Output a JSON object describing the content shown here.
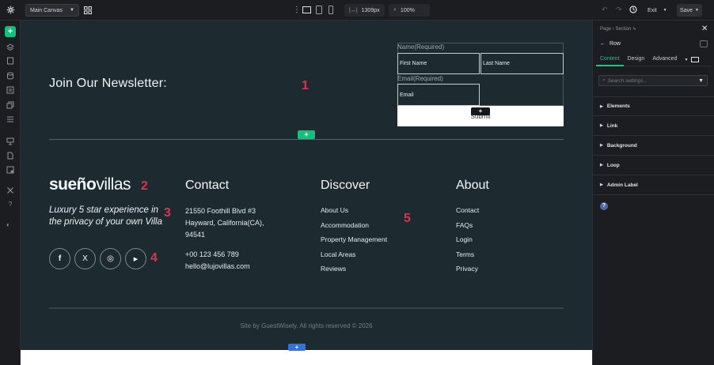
{
  "topbar": {
    "canvas_select": "Main Canvas",
    "width_value": "1309px",
    "zoom_value": "100%",
    "exit_label": "Exit",
    "save_label": "Save"
  },
  "leftbar": {
    "add_label": "+",
    "icons": [
      "layers-icon",
      "pages-icon",
      "database-icon",
      "form-icon",
      "copy-icon",
      "list-icon",
      "template-icon",
      "components-icon",
      "media-icon",
      "tools-icon",
      "help-icon",
      "theme-toggle-icon"
    ]
  },
  "canvas": {
    "newsletter_title": "Join Our Newsletter:",
    "badges": [
      "1",
      "2",
      "3",
      "4",
      "5"
    ],
    "form": {
      "name_label": "Name(Required)",
      "first_name": "First Name",
      "last_name": "Last Name",
      "email_label": "Email(Required)",
      "email_placeholder": "Email",
      "submit_label": "Submit",
      "plus": "+"
    },
    "section_add": "+",
    "logo": {
      "strong": "sueño",
      "light": "villas"
    },
    "tagline": "Luxury 5 star experience in the privacy of your own Villa",
    "socials": [
      "f",
      "X",
      "◎",
      "▶"
    ],
    "contact": {
      "heading": "Contact",
      "address_1": "21550 Foothill Blvd #3",
      "address_2": "Hayward, California(CA),",
      "address_3": "94541",
      "phone": "+00 123 456 789",
      "email": "hello@lujovillas.com"
    },
    "discover": {
      "heading": "Discover",
      "items": [
        "About Us",
        "Accommodation",
        "Property Management",
        "Local Areas",
        "Reviews"
      ]
    },
    "about": {
      "heading": "About",
      "items": [
        "Contact",
        "FAQs",
        "Login",
        "Terms",
        "Privacy"
      ]
    },
    "copyright": "Site by GuestWisely. All rights reserved © 2026",
    "bottom_add": "+"
  },
  "right_panel": {
    "breadcrumb": "Page › Section ↳",
    "element": "Row",
    "tabs": [
      "Content",
      "Design",
      "Advanced"
    ],
    "search_placeholder": "Search settings...",
    "sections": [
      "Elements",
      "Link",
      "Background",
      "Loop",
      "Admin Label"
    ],
    "help": "?"
  },
  "colors": {
    "canvas_bg": "#1d2b31",
    "accent_green": "#14c07f",
    "badge_red": "#d8364f",
    "accent_blue": "#2f73e0"
  }
}
